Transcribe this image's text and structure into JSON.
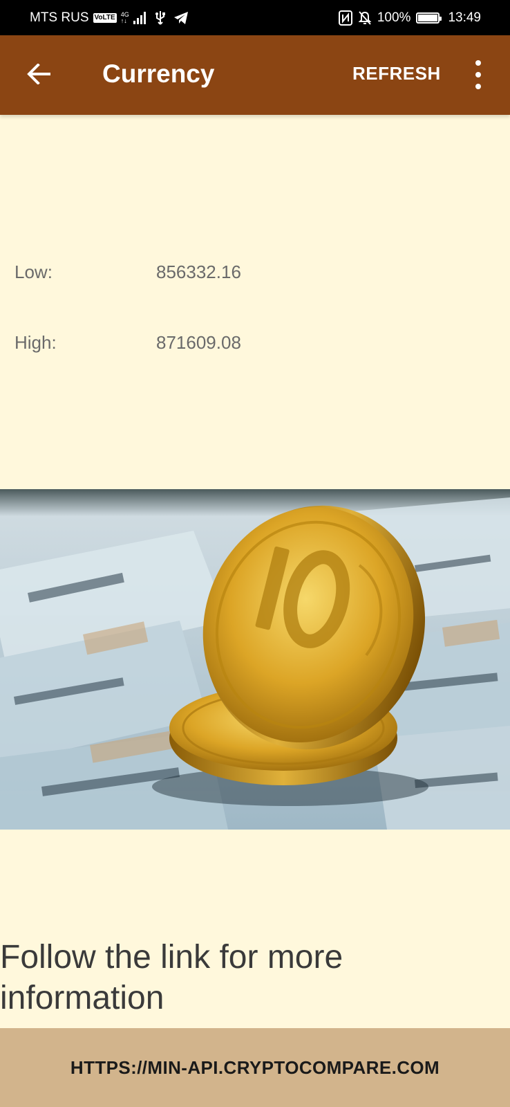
{
  "status_bar": {
    "carrier": "MTS RUS",
    "volte": "VoLTE",
    "network_top": "4G",
    "network_bottom": "↑↓",
    "battery_percent": "100%",
    "battery_level": 1.0,
    "time": "13:49",
    "icons": [
      "usb-icon",
      "telegram-icon",
      "nfc-icon",
      "mute-icon",
      "battery-icon"
    ]
  },
  "app_bar": {
    "title": "Currency",
    "refresh_label": "REFRESH",
    "color": "#8b4513"
  },
  "rates": {
    "low_label": "Low:",
    "low_value": "856332.16",
    "high_label": "High:",
    "high_value": "871609.08"
  },
  "info": {
    "text": "Follow the link for more information"
  },
  "link": {
    "label": "HTTPS://MIN-API.CRYPTOCOMPARE.COM",
    "color": "#d2b48c"
  },
  "colors": {
    "background": "#fff8dc",
    "text_gray": "#6a6a6a"
  }
}
